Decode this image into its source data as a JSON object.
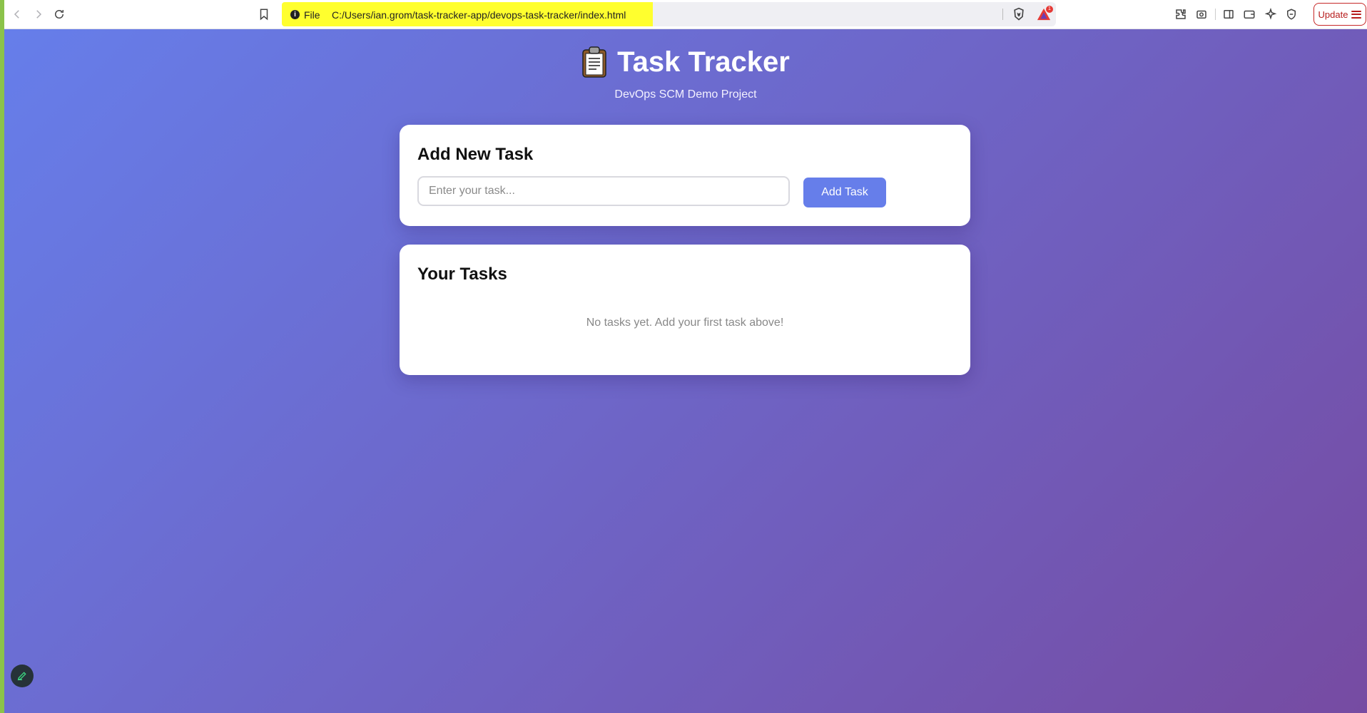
{
  "browser": {
    "address": {
      "security_label": "File",
      "url": "C:/Users/ian.grom/task-tracker-app/devops-task-tracker/index.html"
    },
    "rewards_badge": "1",
    "update_label": "Update",
    "highlight_color": "#ffff2e"
  },
  "app": {
    "title": "Task Tracker",
    "title_icon": "clipboard-icon",
    "subtitle": "DevOps SCM Demo Project",
    "gradient": [
      "#667eea",
      "#764ba2"
    ],
    "add_section": {
      "heading": "Add New Task",
      "input_placeholder": "Enter your task...",
      "input_value": "",
      "button_label": "Add Task",
      "button_color": "#667eea"
    },
    "tasks_section": {
      "heading": "Your Tasks",
      "empty_message": "No tasks yet. Add your first task above!",
      "tasks": []
    }
  }
}
